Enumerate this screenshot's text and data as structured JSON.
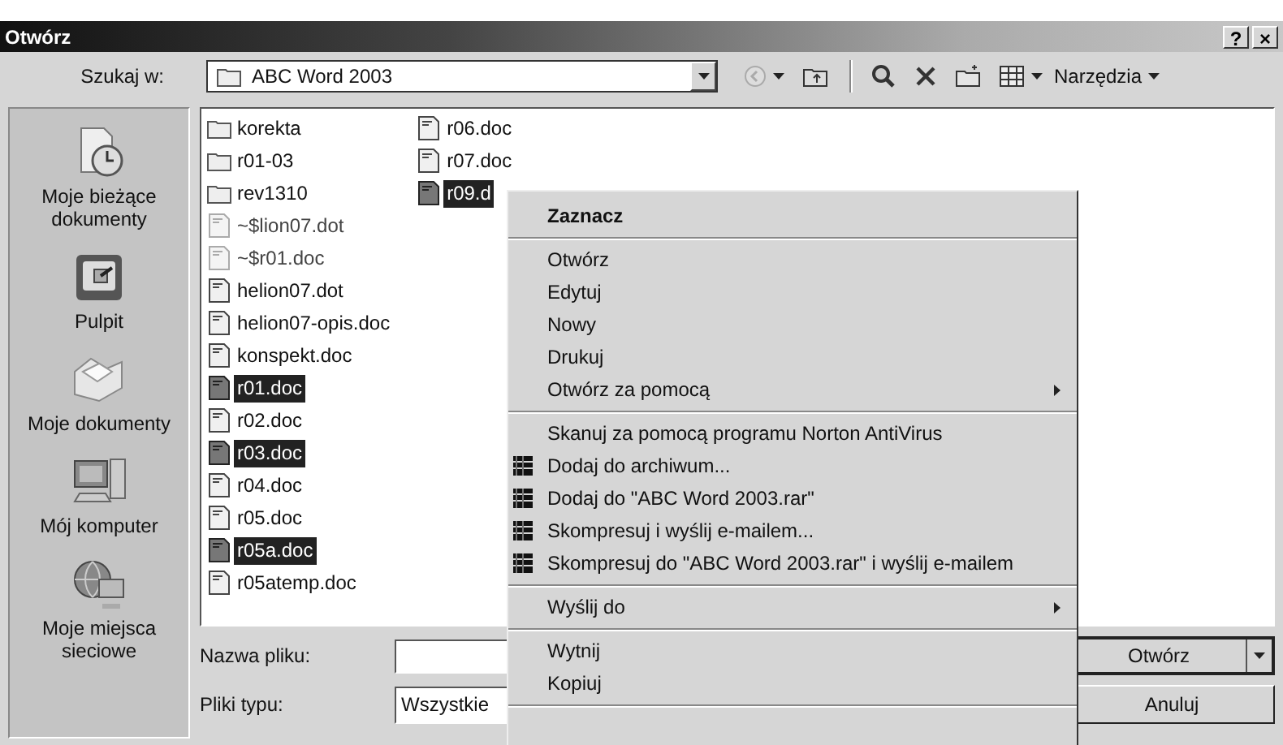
{
  "window": {
    "title": "Otwórz",
    "title_buttons": [
      {
        "label": "?"
      },
      {
        "label": "×"
      }
    ]
  },
  "toolbar": {
    "look_in_label": "Szukaj w:",
    "look_in_value": "ABC Word 2003",
    "tools_label": "Narzędzia",
    "tool_buttons": [
      {
        "kind": "back",
        "disabled": true
      },
      {
        "kind": "up",
        "disabled": false
      },
      {
        "kind": "search",
        "disabled": false
      },
      {
        "kind": "delete",
        "disabled": false
      },
      {
        "kind": "new-folder",
        "disabled": false
      },
      {
        "kind": "views",
        "disabled": false
      }
    ]
  },
  "places": [
    {
      "label": "Moje bieżące dokumenty",
      "kind": "recent"
    },
    {
      "label": "Pulpit",
      "kind": "desktop"
    },
    {
      "label": "Moje dokumenty",
      "kind": "documents"
    },
    {
      "label": "Mój komputer",
      "kind": "computer"
    },
    {
      "label": "Moje miejsca sieciowe",
      "kind": "network"
    }
  ],
  "files": [
    {
      "name": "korekta",
      "kind": "folder",
      "selected": false,
      "hidden": false
    },
    {
      "name": "r01-03",
      "kind": "folder",
      "selected": false,
      "hidden": false
    },
    {
      "name": "rev1310",
      "kind": "folder",
      "selected": false,
      "hidden": false
    },
    {
      "name": "~$lion07.dot",
      "kind": "doc",
      "selected": false,
      "hidden": true
    },
    {
      "name": "~$r01.doc",
      "kind": "doc",
      "selected": false,
      "hidden": true
    },
    {
      "name": "helion07.dot",
      "kind": "doc",
      "selected": false,
      "hidden": false
    },
    {
      "name": "helion07-opis.doc",
      "kind": "doc",
      "selected": false,
      "hidden": false
    },
    {
      "name": "konspekt.doc",
      "kind": "doc",
      "selected": false,
      "hidden": false
    },
    {
      "name": "r01.doc",
      "kind": "doc",
      "selected": true,
      "hidden": false
    },
    {
      "name": "r02.doc",
      "kind": "doc",
      "selected": false,
      "hidden": false
    },
    {
      "name": "r03.doc",
      "kind": "doc",
      "selected": true,
      "hidden": false
    },
    {
      "name": "r04.doc",
      "kind": "doc",
      "selected": false,
      "hidden": false
    },
    {
      "name": "r05.doc",
      "kind": "doc",
      "selected": false,
      "hidden": false
    },
    {
      "name": "r05a.doc",
      "kind": "doc",
      "selected": true,
      "hidden": false
    },
    {
      "name": "r05atemp.doc",
      "kind": "doc",
      "selected": false,
      "hidden": false
    },
    {
      "name": "r06.doc",
      "kind": "doc",
      "selected": false,
      "hidden": false
    },
    {
      "name": "r07.doc",
      "kind": "doc",
      "selected": false,
      "hidden": false
    },
    {
      "name": "r09.d",
      "kind": "doc",
      "selected": true,
      "hidden": false
    }
  ],
  "file_name": {
    "label": "Nazwa pliku:"
  },
  "file_type": {
    "label": "Pliki typu:",
    "value": "Wszystkie"
  },
  "buttons": [
    {
      "label": "Otwórz",
      "kind": "split"
    },
    {
      "label": "Anuluj",
      "kind": "plain"
    }
  ],
  "context_menu": {
    "groups": [
      [
        {
          "label": "Zaznacz",
          "kind": "plain",
          "bold": true,
          "submenu": false
        }
      ],
      [
        {
          "label": "Otwórz",
          "kind": "plain",
          "bold": false,
          "submenu": false
        },
        {
          "label": "Edytuj",
          "kind": "plain",
          "bold": false,
          "submenu": false
        },
        {
          "label": "Nowy",
          "kind": "plain",
          "bold": false,
          "submenu": false
        },
        {
          "label": "Drukuj",
          "kind": "plain",
          "bold": false,
          "submenu": false
        },
        {
          "label": "Otwórz za pomocą",
          "kind": "plain",
          "bold": false,
          "submenu": true
        }
      ],
      [
        {
          "label": "Skanuj za pomocą programu Norton AntiVirus",
          "kind": "plain",
          "bold": false,
          "submenu": false
        },
        {
          "label": "Dodaj do archiwum...",
          "kind": "archive",
          "bold": false,
          "submenu": false
        },
        {
          "label": "Dodaj do \"ABC Word 2003.rar\"",
          "kind": "archive",
          "bold": false,
          "submenu": false
        },
        {
          "label": "Skompresuj i wyślij e-mailem...",
          "kind": "archive",
          "bold": false,
          "submenu": false
        },
        {
          "label": "Skompresuj do \"ABC Word 2003.rar\" i wyślij e-mailem",
          "kind": "archive",
          "bold": false,
          "submenu": false
        }
      ],
      [
        {
          "label": "Wyślij do",
          "kind": "plain",
          "bold": false,
          "submenu": true
        }
      ],
      [
        {
          "label": "Wytnij",
          "kind": "plain",
          "bold": false,
          "submenu": false
        },
        {
          "label": "Kopiuj",
          "kind": "plain",
          "bold": false,
          "submenu": false
        }
      ]
    ]
  }
}
